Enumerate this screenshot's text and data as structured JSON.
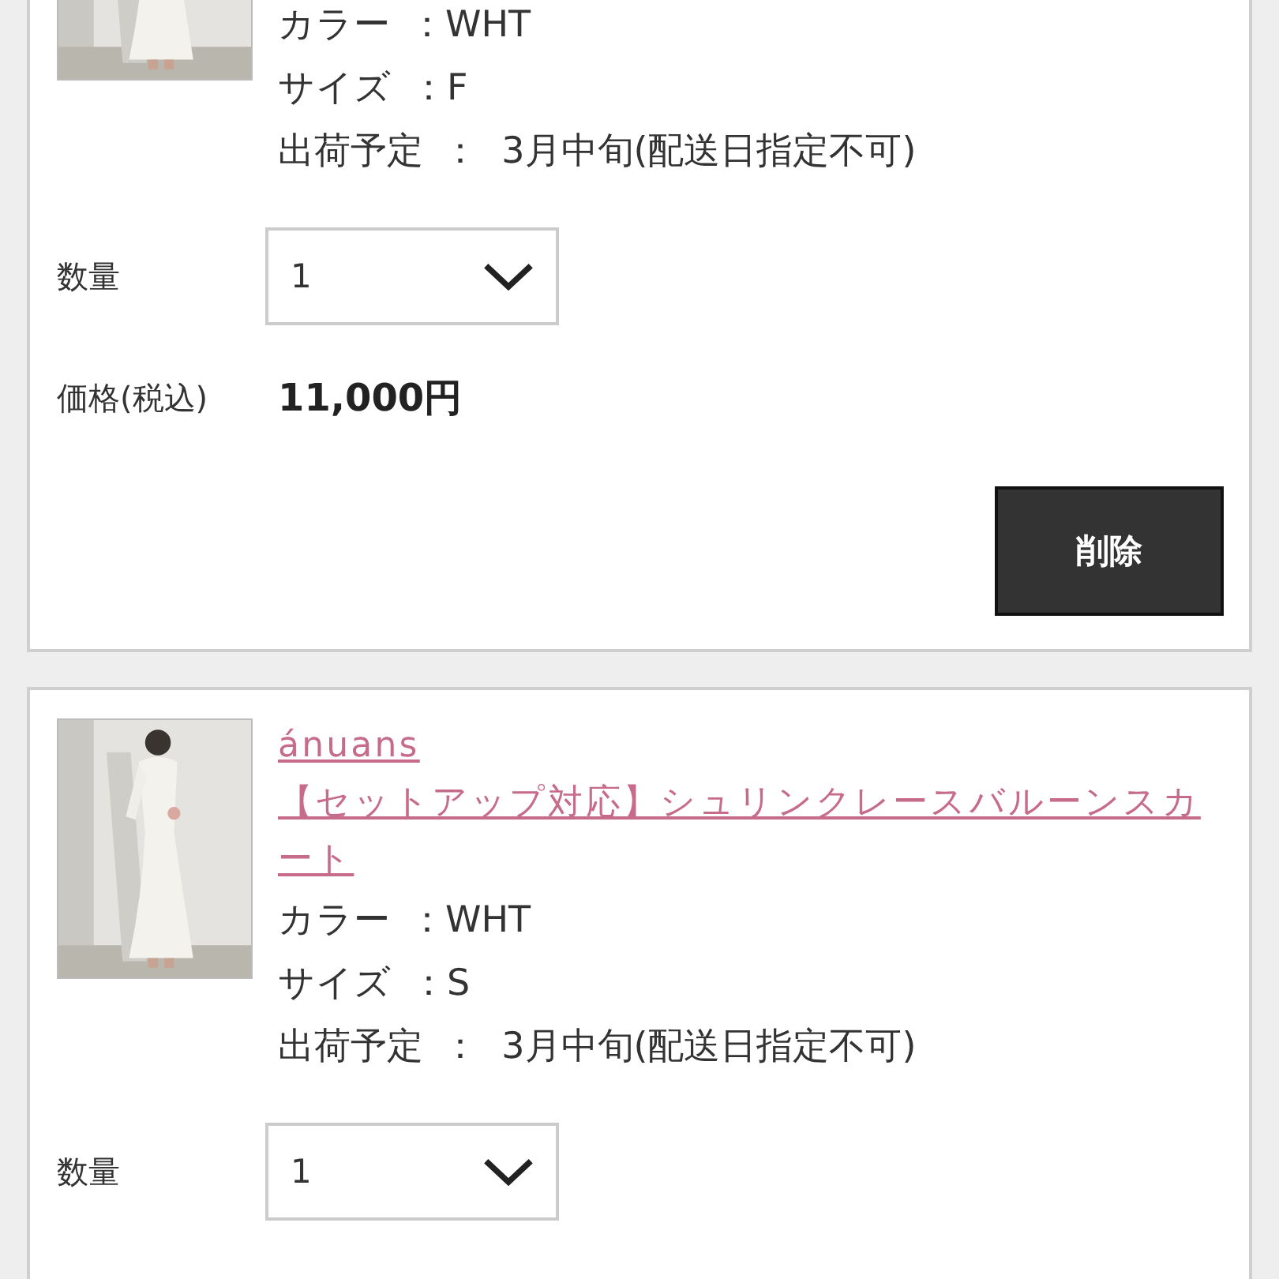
{
  "cart_items": [
    {
      "attributes": [
        {
          "label": "カラー",
          "value": "：WHT"
        },
        {
          "label": "サイズ",
          "value": "：F"
        },
        {
          "label": "出荷予定",
          "value": "：  3月中旬(配送日指定不可)"
        }
      ],
      "quantity_label": "数量",
      "quantity": "1",
      "price_label": "価格(税込)",
      "price": "11,000円",
      "delete_button": "削除"
    },
    {
      "brand": "ánuans",
      "title": "【セットアップ対応】シュリンクレースバルーンスカート",
      "attributes": [
        {
          "label": "カラー",
          "value": "：WHT"
        },
        {
          "label": "サイズ",
          "value": "：S"
        },
        {
          "label": "出荷予定",
          "value": "：  3月中旬(配送日指定不可)"
        }
      ],
      "quantity_label": "数量",
      "quantity": "1"
    }
  ]
}
